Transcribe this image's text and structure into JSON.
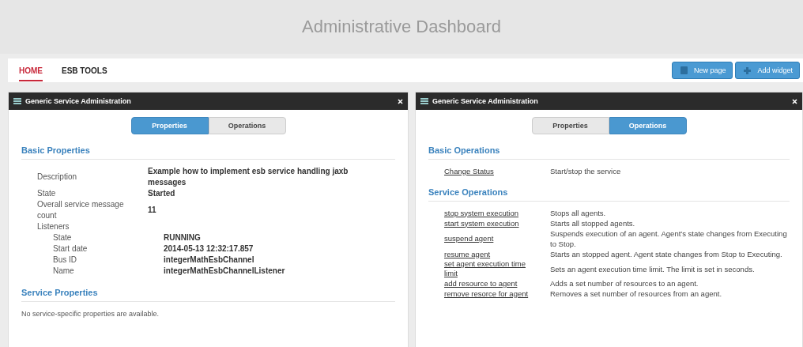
{
  "header": {
    "title": "Administrative Dashboard"
  },
  "nav": {
    "tabs": [
      {
        "label": "HOME",
        "selected": true
      },
      {
        "label": "ESB TOOLS",
        "selected": false
      }
    ],
    "buttons": [
      {
        "label": "New page",
        "kind": "page"
      },
      {
        "label": "Add widget",
        "kind": "add"
      }
    ]
  },
  "panels": [
    {
      "title": "Generic Service Administration",
      "tabs": [
        {
          "label": "Properties",
          "selected": true
        },
        {
          "label": "Operations",
          "selected": false
        }
      ],
      "sections": [
        {
          "heading": "Basic Properties",
          "rows": [
            {
              "label": "Description",
              "value": "Example how to implement esb service handling jaxb messages"
            },
            {
              "label": "State",
              "value": "Started"
            },
            {
              "label": "Overall service message count",
              "value": "11"
            },
            {
              "label": "Listeners",
              "children": [
                {
                  "label": "State",
                  "value": "RUNNING"
                },
                {
                  "label": "Start date",
                  "value": "2014-05-13 12:32:17.857"
                },
                {
                  "label": "Bus ID",
                  "value": "integerMathEsbChannel"
                },
                {
                  "label": "Name",
                  "value": "integerMathEsbChannelListener"
                }
              ]
            }
          ]
        },
        {
          "heading": "Service Properties",
          "note": "No service-specific properties are available."
        }
      ]
    },
    {
      "title": "Generic Service Administration",
      "tabs": [
        {
          "label": "Properties",
          "selected": false
        },
        {
          "label": "Operations",
          "selected": true
        }
      ],
      "sections": [
        {
          "heading": "Basic Operations",
          "ops": [
            {
              "link": "Change Status",
              "text": "Start/stop the service"
            }
          ]
        },
        {
          "heading": "Service Operations",
          "ops": [
            {
              "link": "stop system execution",
              "text": "Stops all agents."
            },
            {
              "link": "start system execution",
              "text": "Starts all stopped agents."
            },
            {
              "link": "suspend agent",
              "text": "Suspends execution of an agent. Agent's state changes from Executing to Stop."
            },
            {
              "link": "resume agent",
              "text": "Starts an stopped agent. Agent state changes from Stop to Executing."
            },
            {
              "link": "set agent execution time limit",
              "text": "Sets an agent execution time limit. The limit is set in seconds."
            },
            {
              "link": "add resource to agent",
              "text": "Adds a set number of resources to an agent."
            },
            {
              "link": "remove resorce for agent",
              "text": "Removes a set number of resources from an agent."
            }
          ]
        }
      ]
    }
  ]
}
